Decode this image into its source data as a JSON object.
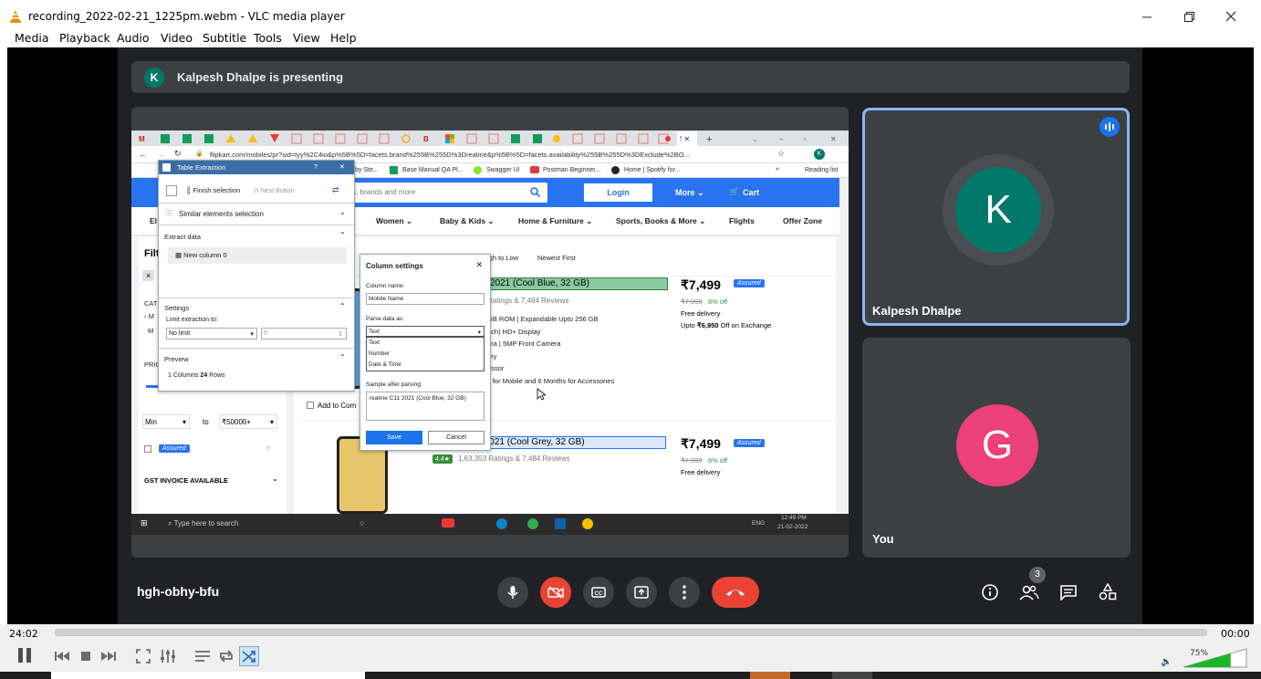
{
  "window": {
    "title": "recording_2022-02-21_1225pm.webm - VLC media player",
    "minimize_icon": "minimize-icon",
    "restore_icon": "restore-icon",
    "close_icon": "close-icon"
  },
  "menu": [
    "Media",
    "Playback",
    "Audio",
    "Video",
    "Subtitle",
    "Tools",
    "View",
    "Help"
  ],
  "meet": {
    "banner_initial": "K",
    "banner_text": "Kalpesh Dhalpe is presenting",
    "presenter_initial": "K",
    "presenter_name": "Kalpesh Dhalpe",
    "self_initial": "G",
    "self_name": "You",
    "meeting_code": "hgh-obhy-bfu",
    "participants_count": "3",
    "colors": {
      "presenter": "#00796b",
      "self": "#ec407a",
      "end_call": "#ea4335",
      "accent": "#8ab4f8"
    }
  },
  "shared_screen": {
    "url": "flipkart.com/mobiles/pr?sid=tyy%2C4io&p%5B%5D=facets.brand%255B%255D%3Drealme&p%5B%5D=facets.availability%255B%255D%3DExclude%2BO...",
    "bookmarks": [
      "by Ste...",
      "Base Manual QA Pl...",
      "Swagger UI",
      "Postman Beginner...",
      "Home | Spotify for...",
      "»",
      "Reading list"
    ],
    "search_placeholder": "ts, brands and more",
    "login": "Login",
    "more": "More ⌄",
    "cart": "Cart",
    "categories": [
      "El",
      "Women ⌄",
      "Baby & Kids ⌄",
      "Home & Furniture ⌄",
      "Sports, Books & More ⌄",
      "Flights",
      "Offer Zone"
    ],
    "sort": [
      "igh to Low",
      "Newest First"
    ],
    "product1": {
      "name": "2021 (Cool Blue, 32 GB)",
      "ratings": "Ratings & 7,484 Reviews",
      "price": "₹7,499",
      "mrp": "₹7,999",
      "off": "6% off",
      "delivery": "Free delivery",
      "exchange_prefix": "Upto ",
      "exchange_amount": "₹6,950",
      "exchange_suffix": " Off on Exchange",
      "specs": [
        "GB ROM | Expandable Upto 256 GB",
        "nch) HD+ Display",
        "era | 5MP Front Camera",
        "ery",
        "essor",
        "y for Mobile and 6 Months for Accessories"
      ],
      "assured": "Assured",
      "compare": "Add to Com"
    },
    "product2": {
      "name": "realme C11 2021 (Cool Grey, 32 GB)",
      "rating": "4.4★",
      "ratings": "1,63,353 Ratings & 7,484 Reviews",
      "price": "₹7,499",
      "mrp": "₹7,999",
      "off": "6% off",
      "delivery": "Free delivery",
      "assured": "Assured"
    },
    "filters": {
      "title": "Filt",
      "x": "×",
      "cat": "CATE",
      "m_arrow": "‹ M",
      "m": "M",
      "price": "PRIC",
      "min": "Min",
      "to": "to",
      "max": "₹50000+",
      "assured": "Assured",
      "help": "?",
      "gst": "GST INVOICE AVAILABLE"
    },
    "table_extraction": {
      "title": "Table Extraction",
      "help": "?",
      "finish": "Finish selection",
      "next": "Next Button",
      "similar": "Similar elements selection",
      "extract": "Extract data",
      "column": "New column 0",
      "settings": "Settings",
      "limit_label": "Limit extraction to:",
      "limit_value": "No limit",
      "limit_num": "0",
      "preview": "Preview",
      "preview_columns": "1",
      "preview_columns_label": " Columns ",
      "preview_rows": "24",
      "preview_rows_label": " Rows"
    },
    "column_settings": {
      "title": "Column settings",
      "name_label": "Column name:",
      "name_value": "Mobile Name",
      "parse_label": "Parse data as:",
      "parse_selected": "Text",
      "options": [
        "Text",
        "Number",
        "Date & Time"
      ],
      "sample_label": "Sample after parsing:",
      "sample_value": "realme C11 2021 (Cool Blue, 32 GB)",
      "save": "Save",
      "cancel": "Cancel"
    },
    "taskbar": {
      "search": "Type here to search",
      "lang": "ENG",
      "time": "12:49 PM",
      "date": "21-02-2022"
    }
  },
  "player": {
    "elapsed": "24:02",
    "remaining": "00:00",
    "progress": 1.0,
    "volume": "75%",
    "volume_level": 0.75
  }
}
